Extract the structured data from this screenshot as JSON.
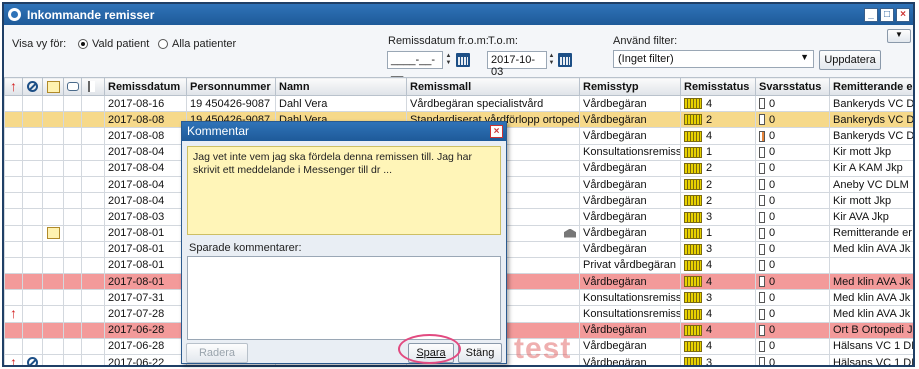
{
  "window": {
    "title": "Inkommande remisser"
  },
  "filter": {
    "view_label": "Visa vy för:",
    "option_selected_patient": "Vald patient",
    "option_all_patients": "Alla patienter",
    "selected_option": "Vald patient",
    "date_from_label": "Remissdatum fr.o.m:",
    "date_from_value": "____-__-__",
    "date_to_label": "T.o.m:",
    "date_to_value": "2017-10-03",
    "filter_label": "Använd filter:",
    "filter_value": "(Inget filter)",
    "update_button": "Uppdatera"
  },
  "table": {
    "columns": [
      "Remissdatum",
      "Personnummer",
      "Namn",
      "Remissmall",
      "Remisstyp",
      "Remisstatus",
      "Svarsstatus",
      "Remitterande en"
    ],
    "rows": [
      {
        "date": "2017-08-16",
        "pnr": "19 450426-9087",
        "name": "Dahl Vera",
        "template": "Vårdbegäran specialistvård",
        "type": "Vårdbegäran",
        "status": "4",
        "answer": "0",
        "referrer": "Bankeryds VC DL",
        "style": "row",
        "icons": []
      },
      {
        "date": "2017-08-08",
        "pnr": "19 450426-9087",
        "name": "Dahl Vera",
        "template": "Standardiserat vårdförlopp ortopedi",
        "type": "Vårdbegäran",
        "status": "2",
        "answer": "0",
        "referrer": "Bankeryds VC D",
        "style": "sel",
        "icons": []
      },
      {
        "date": "2017-08-08",
        "pnr": "",
        "name": "",
        "template": "stvård",
        "type": "Vårdbegäran",
        "status": "4",
        "answer": "0",
        "referrer": "Bankeryds VC D",
        "style": "row",
        "icons": [],
        "answer_orange": true
      },
      {
        "date": "2017-08-04",
        "pnr": "",
        "name": "",
        "template": "",
        "type": "Konsultationsremiss",
        "status": "1",
        "answer": "0",
        "referrer": "Kir mott Jkp",
        "style": "row",
        "icons": []
      },
      {
        "date": "2017-08-04",
        "pnr": "",
        "name": "",
        "template": "stvård",
        "type": "Vårdbegäran",
        "status": "2",
        "answer": "0",
        "referrer": "Kir A KAM Jkp",
        "style": "row",
        "icons": []
      },
      {
        "date": "2017-08-04",
        "pnr": "",
        "name": "",
        "template": "stvård",
        "type": "Vårdbegäran",
        "status": "2",
        "answer": "0",
        "referrer": "Aneby VC DLM",
        "style": "row",
        "icons": []
      },
      {
        "date": "2017-08-04",
        "pnr": "",
        "name": "",
        "template": "stvård",
        "type": "Vårdbegäran",
        "status": "2",
        "answer": "0",
        "referrer": "Kir mott Jkp",
        "style": "row",
        "icons": []
      },
      {
        "date": "2017-08-03",
        "pnr": "",
        "name": "",
        "template": "stvård",
        "type": "Vårdbegäran",
        "status": "3",
        "answer": "0",
        "referrer": "Kir AVA Jkp",
        "style": "row",
        "icons": []
      },
      {
        "date": "2017-08-01",
        "pnr": "",
        "name": "",
        "template": "kommande",
        "type": "Vårdbegäran",
        "status": "1",
        "answer": "0",
        "referrer": "Remitterande er",
        "style": "row",
        "icons": [
          "note"
        ],
        "house": true
      },
      {
        "date": "2017-08-01",
        "pnr": "",
        "name": "",
        "template": "stvård",
        "type": "Vårdbegäran",
        "status": "3",
        "answer": "0",
        "referrer": "Med klin AVA Jk",
        "style": "row",
        "icons": []
      },
      {
        "date": "2017-08-01",
        "pnr": "",
        "name": "",
        "template": "",
        "type": "Privat vårdbegäran",
        "status": "4",
        "answer": "0",
        "referrer": "",
        "style": "row",
        "icons": []
      },
      {
        "date": "2017-08-01",
        "pnr": "",
        "name": "",
        "template": "",
        "type": "Vårdbegäran",
        "status": "4",
        "answer": "0",
        "referrer": "Med klin AVA Jk",
        "style": "red",
        "icons": []
      },
      {
        "date": "2017-07-31",
        "pnr": "",
        "name": "",
        "template": "",
        "type": "Konsultationsremiss",
        "status": "3",
        "answer": "0",
        "referrer": "Med klin AVA Jk",
        "style": "row",
        "icons": []
      },
      {
        "date": "2017-07-28",
        "pnr": "",
        "name": "",
        "template": "",
        "type": "Konsultationsremiss",
        "status": "4",
        "answer": "0",
        "referrer": "Med klin AVA Jk",
        "style": "row",
        "icons": [
          "arrow"
        ]
      },
      {
        "date": "2017-06-28",
        "pnr": "",
        "name": "",
        "template": "agning",
        "type": "Vårdbegäran",
        "status": "4",
        "answer": "0",
        "referrer": "Ort B Ortopedi Jk",
        "style": "red",
        "icons": []
      },
      {
        "date": "2017-06-28",
        "pnr": "",
        "name": "",
        "template": "",
        "type": "Vårdbegäran",
        "status": "4",
        "answer": "0",
        "referrer": "Hälsans VC 1 DL",
        "style": "row",
        "icons": []
      },
      {
        "date": "2017-06-22",
        "pnr": "",
        "name": "",
        "template": "",
        "type": "Vårdbegäran",
        "status": "3",
        "answer": "0",
        "referrer": "Hälsans VC 1 DL",
        "style": "row",
        "icons": [
          "arrow",
          "noentry"
        ]
      }
    ]
  },
  "dialog": {
    "title": "Kommentar",
    "comment_text": "Jag vet inte vem jag ska fördela denna remissen till. Jag har skrivit ett meddelande i Messenger till dr ...",
    "saved_label": "Sparade kommentarer:",
    "delete_button": "Radera",
    "save_button": "Spara",
    "close_button": "Stäng"
  },
  "watermark": "test",
  "colors": {
    "titlebar": "#1e5a99",
    "selected_row": "#f6d98a",
    "red_row": "#f39a9a",
    "comment_bg": "#fff5b8",
    "highlight": "#e24a80"
  }
}
